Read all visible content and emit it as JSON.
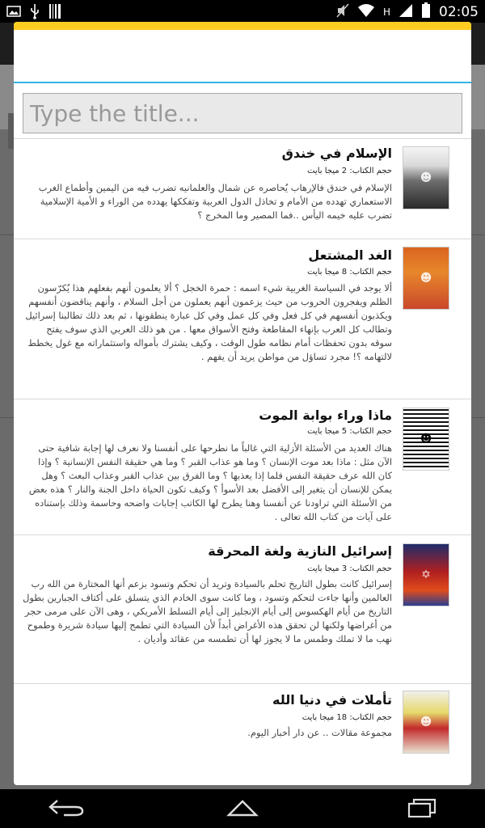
{
  "status_bar": {
    "time": "02:05",
    "network_letter": "H",
    "left_icons": [
      "image-icon",
      "usb-icon",
      "barcode-icon"
    ],
    "right_icons": [
      "no-sound-icon",
      "wifi-icon",
      "signal-icon",
      "battery-icon"
    ]
  },
  "dialog": {
    "accent_color": "#ffcc22",
    "divider_color": "#33b5e5",
    "search": {
      "placeholder": "Type the title...",
      "value": ""
    }
  },
  "books": [
    {
      "title": "الإسلام في خندق",
      "size": "حجم الكتاب: 2 ميجا بايت",
      "description": "الإسلام في خندق فالإرهاب يُحاصره عن شمال والعلمانيه تضرب فيه من اليمين وأطماع الغرب الاستعماري تهدده من الأمام و تخاذل الدول العربية وتفككها يهدده من الوراء و الأمية الإسلامية تضرب عليه خيمه اليأس ..فما المصير وما المخرج ؟"
    },
    {
      "title": "الغد المشتعل",
      "size": "حجم الكتاب: 8 ميجا بايت",
      "description": "ألا يوجد في السياسة الغربية شيء اسمه : حمرة الخجل ؟ ألا يعلمون أنهم بفعلهم هذا يُكرّسون الظلم ويفجرون الحروب من حيث يزعمون أنهم يعملون من أجل السلام ، وأنهم يناقضون أنفسهم ويكذبون أنفسهم في كل فعل وفي كل عمل وفي كل عبارة ينطقونها ، ثم بعد ذلك تطالبنا إسرائيل وتطالب كل العرب بإنهاء المقاطعة وفتح الأسواق معها . من هو ذلك العربي الذي سوف يفتح سوقه بدون تحفظات أمام نظامه طول الوقت ، وكيف يشترك بأمواله واستثماراته مع غول يخطط لالتهامه ؟! مجرد تساؤل من مواطن يريد أن يفهم ."
    },
    {
      "title": "ماذا وراء بوابة الموت",
      "size": "حجم الكتاب: 5 ميجا بايت",
      "description": "هناك العديد من الأسئلة الأزلية التي غالباً ما نطرحها على أنفسنا ولا نعرف لها إجابة شافية حتى الآن مثل : ماذا بعد موت الإنسان ؟ وما هو عذاب القبر ؟ وما هي حقيقة النفس الإنسانية ؟ وإذا كان الله عرف حقيقة النفس فلما إذا يعذبها ؟ وما الفرق بين عذاب القبر وعذاب البعث ؟ وهل يمكن للإنسان أن يتغير إلى الأفضل بعد الأسوأ ؟ وكيف تكون الحياة داخل الجنة والنار ؟ هذه بعض من الأسئلة التي تراودنا عن أنفسنا وهنا يطرح لها الكاتب إجابات واضحه وحاسمة وذلك بإستناده على آيات من كتاب الله تعالى ."
    },
    {
      "title": "إسرائيل النازية ولغة المحرقة",
      "size": "حجم الكتاب: 3 ميجا بايت",
      "description": "إسرائيل كانت بطول التاريخ تحلم بالسيادة وتريد أن تحكم وتسود بزعم أنها المختارة من الله رب العالمين وأنها جاءت لتحكم وتسود ، وما كانت سوى الخادم الذي يتسلق على أكتاف الجبارين بطول التاريخ من أيام الهكسوس إلى أيام الإنجليز إلى أيام التسلط الأمريكي ، وهى الآن على مرمى حجر من أغراضها ولكنها لن تحقق هذه الأغراض أبداً لأن السيادة التي تطمح إليها سيادة شريرة وطموح نهب ما لا تملك وطمس ما لا يجوز لها أن تطمسه من عقائد وأديان ."
    },
    {
      "title": "تأملات في دنيا الله",
      "size": "حجم الكتاب: 18 ميجا بايت",
      "description": "مجموعة مقالات .. عن دار أخبار اليوم."
    }
  ],
  "nav_bar": {
    "icons": [
      "back-icon",
      "home-icon",
      "recent-apps-icon"
    ]
  }
}
